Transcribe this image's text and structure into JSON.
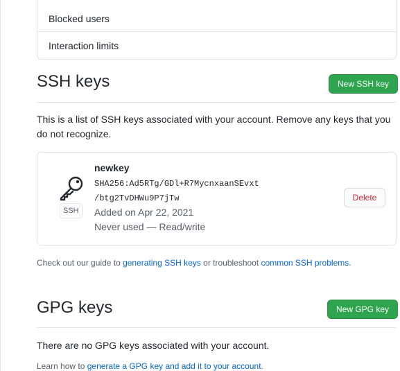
{
  "settings_menu": {
    "items": [
      {
        "label": "Blocked users"
      },
      {
        "label": "Interaction limits"
      }
    ]
  },
  "ssh": {
    "title": "SSH keys",
    "new_button": "New SSH key",
    "description": "This is a list of SSH keys associated with your account. Remove any keys that you do not recognize.",
    "key": {
      "name": "newkey",
      "fingerprint_line1": "SHA256:Ad5RTg/GDl+R7MycnxaanSEvxt",
      "fingerprint_line2": "/btg2TvDHWu9P7jTw",
      "added": "Added on Apr 22, 2021",
      "usage": "Never used — Read/write",
      "type_label": "SSH",
      "delete_button": "Delete",
      "icon": "key-icon"
    },
    "guide": {
      "prefix": "Check out our guide to ",
      "link1": "generating SSH keys",
      "middle": " or troubleshoot ",
      "link2": "common SSH problems",
      "suffix": "."
    }
  },
  "gpg": {
    "title": "GPG keys",
    "new_button": "New GPG key",
    "empty_message": "There are no GPG keys associated with your account.",
    "learn": {
      "prefix": "Learn how to ",
      "link": "generate a GPG key and add it to your account",
      "suffix": "."
    }
  },
  "colors": {
    "primary_button": "#2ea44f",
    "link": "#0366d6",
    "danger": "#cb2431",
    "border": "#e1e4e8"
  }
}
